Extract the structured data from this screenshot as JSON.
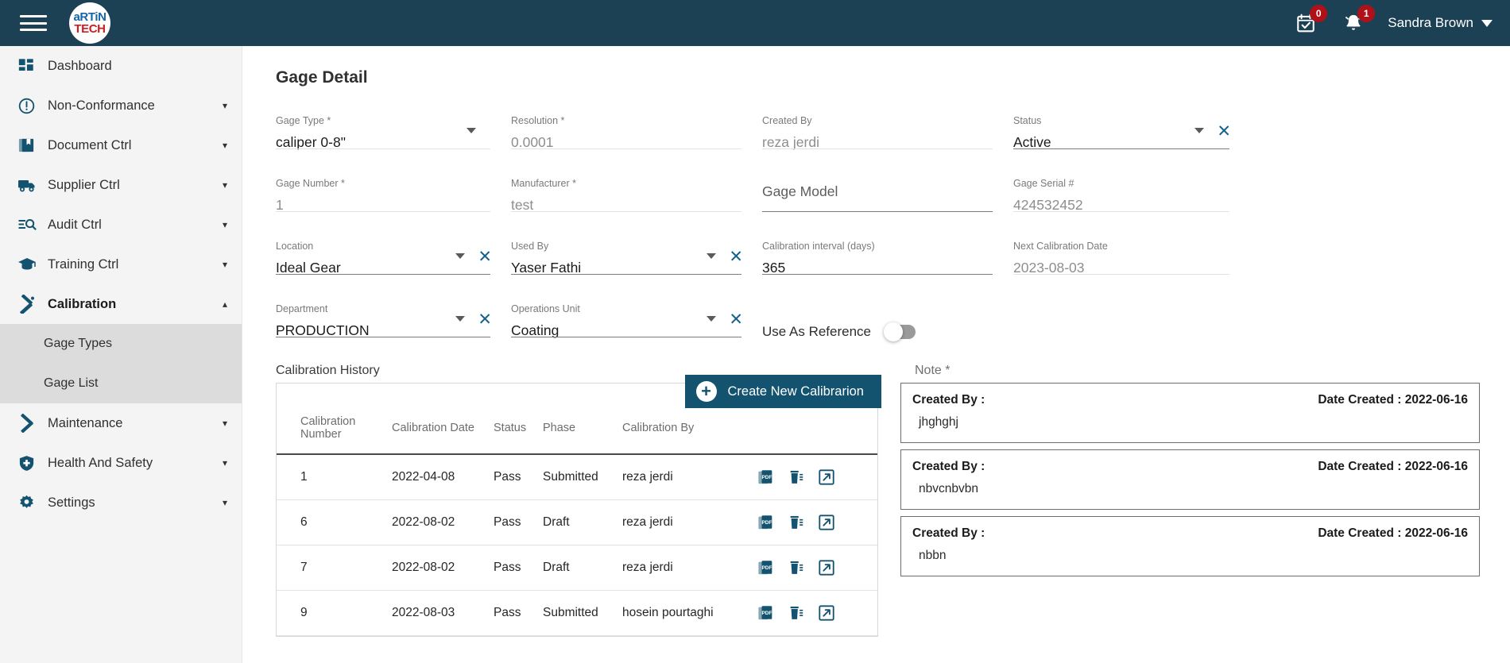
{
  "topbar": {
    "logo_line1": "aRTiN",
    "logo_line2": "TECH",
    "calendar_badge": "0",
    "bell_badge": "1",
    "user_name": "Sandra Brown"
  },
  "sidebar": {
    "items": [
      {
        "label": "Dashboard",
        "icon": "dashboard-icon",
        "expandable": false,
        "active": false
      },
      {
        "label": "Non-Conformance",
        "icon": "alert-circle-icon",
        "expandable": true,
        "active": false
      },
      {
        "label": "Document Ctrl",
        "icon": "book-icon",
        "expandable": true,
        "active": false
      },
      {
        "label": "Supplier Ctrl",
        "icon": "truck-icon",
        "expandable": true,
        "active": false
      },
      {
        "label": "Audit Ctrl",
        "icon": "search-list-icon",
        "expandable": true,
        "active": false
      },
      {
        "label": "Training Ctrl",
        "icon": "graduation-cap-icon",
        "expandable": true,
        "active": false
      },
      {
        "label": "Calibration",
        "icon": "calibration-tools-icon",
        "expandable": true,
        "active": true
      },
      {
        "label": "Maintenance",
        "icon": "hammer-wrench-icon",
        "expandable": true,
        "active": false
      },
      {
        "label": "Health And Safety",
        "icon": "shield-plus-icon",
        "expandable": true,
        "active": false
      },
      {
        "label": "Settings",
        "icon": "gear-icon",
        "expandable": true,
        "active": false
      }
    ],
    "calibration_subitems": [
      {
        "label": "Gage Types"
      },
      {
        "label": "Gage List"
      }
    ]
  },
  "page": {
    "title": "Gage Detail"
  },
  "form": {
    "gage_type": {
      "label": "Gage Type *",
      "value": "caliper 0-8\""
    },
    "resolution": {
      "label": "Resolution *",
      "value": "0.0001"
    },
    "created_by": {
      "label": "Created By",
      "value": "reza jerdi"
    },
    "status": {
      "label": "Status",
      "value": "Active"
    },
    "gage_number": {
      "label": "Gage Number *",
      "value": "1"
    },
    "manufacturer": {
      "label": "Manufacturer *",
      "value": "test"
    },
    "gage_model": {
      "label": "Gage Model",
      "value": ""
    },
    "gage_serial": {
      "label": "Gage Serial #",
      "value": "424532452"
    },
    "location": {
      "label": "Location",
      "value": "Ideal Gear"
    },
    "used_by": {
      "label": "Used By",
      "value": "Yaser Fathi"
    },
    "calibration_interval": {
      "label": "Calibration interval (days)",
      "value": "365"
    },
    "next_calibration_date": {
      "label": "Next Calibration Date",
      "value": "2023-08-03"
    },
    "department": {
      "label": "Department",
      "value": "PRODUCTION"
    },
    "operations_unit": {
      "label": "Operations Unit",
      "value": "Coating"
    },
    "use_as_reference": {
      "label": "Use As Reference",
      "state": "off"
    }
  },
  "history": {
    "title": "Calibration History",
    "create_button": "Create New Calibrarion",
    "columns": [
      "Calibration Number",
      "Calibration Date",
      "Status",
      "Phase",
      "Calibration By"
    ],
    "rows": [
      {
        "number": "1",
        "date": "2022-04-08",
        "status": "Pass",
        "phase": "Submitted",
        "by": "reza jerdi"
      },
      {
        "number": "6",
        "date": "2022-08-02",
        "status": "Pass",
        "phase": "Draft",
        "by": "reza jerdi"
      },
      {
        "number": "7",
        "date": "2022-08-02",
        "status": "Pass",
        "phase": "Draft",
        "by": "reza jerdi"
      },
      {
        "number": "9",
        "date": "2022-08-03",
        "status": "Pass",
        "phase": "Submitted",
        "by": "hosein pourtaghi"
      }
    ],
    "row_action_icons": [
      "pdf-icon",
      "delete-icon",
      "open-external-icon"
    ]
  },
  "notes": {
    "label": "Note *",
    "created_by_label": "Created By :",
    "date_created_label": "Date Created :",
    "cards": [
      {
        "created_by": "Created By :",
        "date": "Date Created : 2022-06-16",
        "text": "jhghghj"
      },
      {
        "created_by": "Created By :",
        "date": "Date Created : 2022-06-16",
        "text": "nbvcnbvbn"
      },
      {
        "created_by": "Created By :",
        "date": "Date Created : 2022-06-16",
        "text": "nbbn"
      }
    ]
  },
  "colors": {
    "brand_dark": "#1d4154",
    "accent": "#14536f",
    "badge_red": "#b01018",
    "sidebar_bg": "#f4f4f4",
    "subnav_bg": "#dcdcdc"
  }
}
